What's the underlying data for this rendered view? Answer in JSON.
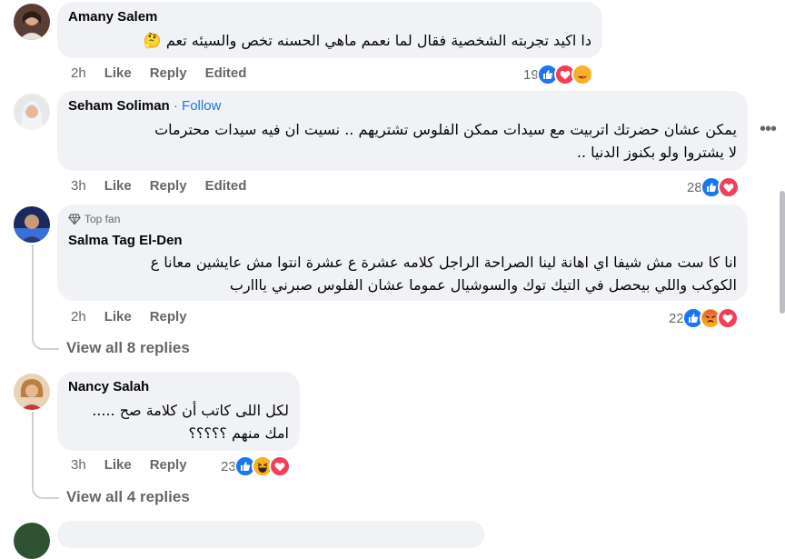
{
  "comments": [
    {
      "author": "Amany Salem",
      "text_lines": [
        "دا اكيد تجربته الشخصية فقال لما نعمم ماهي الحسنه تخص والسيئه تعم 🤔"
      ],
      "time": "2h",
      "like": "Like",
      "reply": "Reply",
      "edited": "Edited",
      "reaction_count": "19"
    },
    {
      "author": "Seham Soliman",
      "separator": "·",
      "follow": "Follow",
      "text_lines": [
        "يمكن عشان حضرتك اتربيت مع سيدات ممكن الفلوس تشتريهم .. نسيت ان فيه سيدات محترمات",
        "لا يشتروا ولو بكنوز الدنيا .."
      ],
      "time": "3h",
      "like": "Like",
      "reply": "Reply",
      "edited": "Edited",
      "reaction_count": "28"
    },
    {
      "badge": "Top fan",
      "author": "Salma Tag El-Den",
      "text_lines": [
        "انا كا ست مش شيفا اي اهانة لينا الصراحة الراجل كلامه عشرة ع عشرة انتوا مش عايشين معانا ع",
        "الكوكب واللي بيحصل في التيك توك والسوشيال عموما عشان الفلوس صبرني يااارب"
      ],
      "time": "2h",
      "like": "Like",
      "reply": "Reply",
      "reaction_count": "22",
      "view_replies": "View all 8 replies"
    },
    {
      "author": "Nancy Salah",
      "text_lines": [
        "لكل اللى كاتب أن كلامة صح .....",
        "امك منهم ؟؟؟؟؟"
      ],
      "time": "3h",
      "like": "Like",
      "reply": "Reply",
      "reaction_count": "23",
      "view_replies": "View all 4 replies"
    }
  ],
  "colors": {
    "like": "#1877f2",
    "love": "#f33e58",
    "link": "#1877f2",
    "meta": "#65676b",
    "bubble": "#f0f2f5"
  },
  "icons": [
    "more-options-icon",
    "top-fan-diamond-icon",
    "like-reaction-icon",
    "love-reaction-icon",
    "care-reaction-icon",
    "angry-reaction-icon",
    "haha-reaction-icon"
  ]
}
